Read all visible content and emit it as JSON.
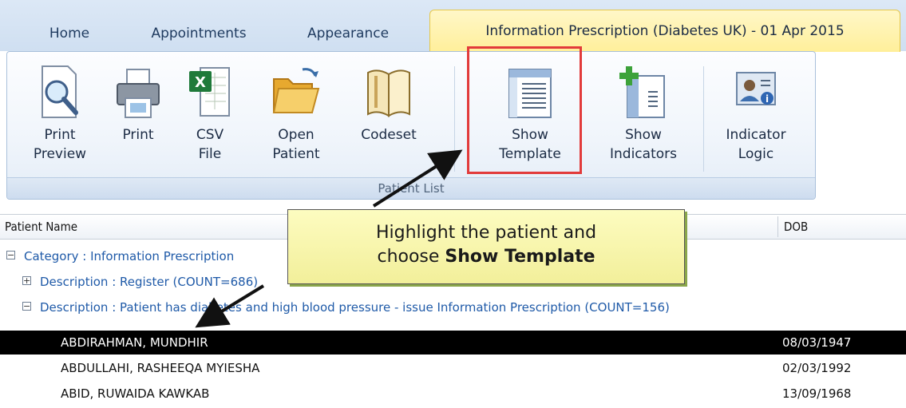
{
  "tabs": [
    {
      "label": "Home"
    },
    {
      "label": "Appointments"
    },
    {
      "label": "Appearance"
    },
    {
      "label": "Information Prescription (Diabetes UK) - 01 Apr 2015",
      "active": true
    }
  ],
  "ribbon": {
    "group_label": "Patient List",
    "buttons": [
      {
        "label": "Print\nPreview",
        "icon": "magnifier-icon"
      },
      {
        "label": "Print",
        "icon": "printer-icon"
      },
      {
        "label": "CSV\nFile",
        "icon": "excel-icon"
      },
      {
        "label": "Open\nPatient",
        "icon": "folder-open-icon"
      },
      {
        "label": "Codeset",
        "icon": "book-icon"
      },
      {
        "label": "Show\nTemplate",
        "icon": "template-icon"
      },
      {
        "label": "Show\nIndicators",
        "icon": "add-indicator-icon"
      },
      {
        "label": "Indicator\nLogic",
        "icon": "indicator-logic-icon"
      }
    ]
  },
  "grid": {
    "columns": [
      "Patient Name",
      "DOB"
    ],
    "category_row": "Category : Information Prescription",
    "register_row": "Description : Register (COUNT=686)",
    "description_row": "Description : Patient has diabetes and high blood pressure - issue Information Prescription (COUNT=156)",
    "patients": [
      {
        "name": "ABDIRAHMAN, MUNDHIR",
        "dob": "08/03/1947",
        "selected": true
      },
      {
        "name": "ABDULLAHI, RASHEEQA MYIESHA",
        "dob": "02/03/1992"
      },
      {
        "name": "ABID, RUWAIDA KAWKAB",
        "dob": "13/09/1968"
      }
    ]
  },
  "callout": {
    "line1": "Highlight the patient and",
    "line2_prefix": "choose ",
    "line2_bold": "Show Template"
  },
  "colors": {
    "highlight_border": "#e23b3b",
    "active_tab": "#ffef9a",
    "group_link": "#1f5aa8",
    "callout_bg": "#f6f3a8"
  }
}
